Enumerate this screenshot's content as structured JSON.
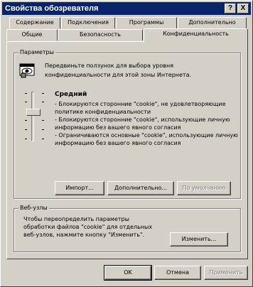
{
  "window": {
    "title": "Свойства обозревателя",
    "help_button": "?",
    "close_button": "X"
  },
  "tabs_back": [
    {
      "label": "Содержание"
    },
    {
      "label": "Подключения"
    },
    {
      "label": "Программы"
    },
    {
      "label": "Дополнительно"
    }
  ],
  "tabs_front": [
    {
      "label": "Общие"
    },
    {
      "label": "Безопасность"
    },
    {
      "label": "Конфиденциальность",
      "active": true
    }
  ],
  "settings": {
    "group_title": "Параметры",
    "description": "Передвиньте ползунок для выбора уровня конфиденциальности для этой зоны Интернета.",
    "level_name": "Средний",
    "level_description": [
      "- Блокируются сторонние \"cookie\", не удовлетворяющие политике конфиденциальности",
      "- Блокируются сторонние \"cookie\", использующие личную информацию без вашего явного согласия",
      "- Ограничиваются основные \"cookie\", использующие личную информацию без вашего явного согласия"
    ],
    "slider_level_fraction": 0.5,
    "buttons": {
      "import": "Импорт...",
      "advanced": "Дополнительно...",
      "default": "По умолчанию"
    }
  },
  "websites": {
    "group_title": "Веб-узлы",
    "text": "Чтобы переопределить параметры обработки файлов \"cookie\" для отдельных веб-узлов, нажмите кнопку \"Изменить\".",
    "edit_button": "Изменить..."
  },
  "footer": {
    "ok": "OK",
    "cancel": "Отмена",
    "apply": "Применить"
  },
  "colors": {
    "titlebar": "#0a246a",
    "face": "#d4d0c8"
  }
}
